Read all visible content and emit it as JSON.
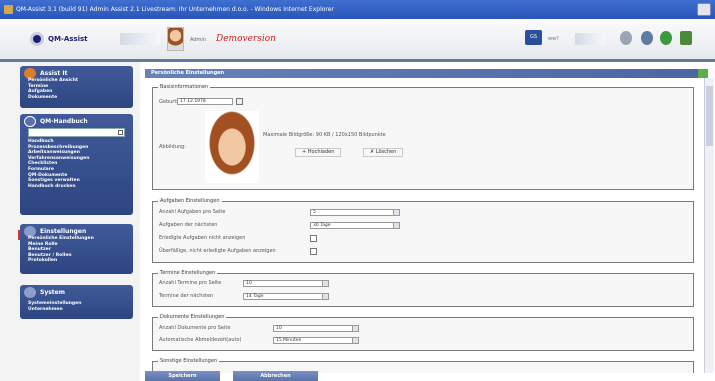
{
  "window": {
    "title": "QM-Assist 3.1 (build 91) Admin Assist 2.1 Livestream: Ihr Unternehmen d.o.o. - Windows Internet Explorer"
  },
  "header": {
    "logo_text": "QM-Assist",
    "user_name": "Admin",
    "demo_label": "Demoversion",
    "gs_badge": "GS",
    "gs_text": "ww?"
  },
  "sidebar": {
    "assist": {
      "title": "Assist It",
      "items": [
        "Persönliche Ansicht",
        "Termine",
        "Aufgaben",
        "Dokumente"
      ]
    },
    "handbook": {
      "title": "QM-Handbuch",
      "items": [
        "Handbuch",
        "Prozessbeschreibungen",
        "Arbeitsanweisungen",
        "Verfahrensanweisungen",
        "Checklisten",
        "Formulare",
        "QM-Dokumente",
        "Sonstiges verwalten",
        "Handbuch drucken"
      ]
    },
    "settings": {
      "title": "Einstellungen",
      "items": [
        "Persönliche Einstellungen",
        "Meine Rolle",
        "Benutzer",
        "Benutzer / Rollen",
        "Protokollen"
      ]
    },
    "system": {
      "title": "System",
      "items": [
        "Systemeinstellungen",
        "Unternehmen"
      ]
    }
  },
  "main": {
    "title": "Persönliche Einstellungen",
    "basic": {
      "title": "Basisinformationen",
      "birthday_label": "Geburtstag:",
      "birthday_value": "17.12.1978",
      "photo_label": "Abbildung:",
      "max_size_text": "Maximale Bildgröße: 90 KB / 120x150 Bildpunkte",
      "upload_label": "+ Hochladen",
      "delete_label": "✗ Löschen"
    },
    "tasks": {
      "title": "Aufgaben Einstellungen",
      "rows": [
        {
          "label": "Anzahl Aufgaben pro Seite",
          "value": "5"
        },
        {
          "label": "Aufgaben der nächsten",
          "value": "30 Tage"
        },
        {
          "label": "Erledigte Aufgaben nicht anzeigen"
        },
        {
          "label": "Überfällige, nicht erledigte Aufgaben anzeigen"
        }
      ]
    },
    "appointments": {
      "title": "Termine Einstellungen",
      "rows": [
        {
          "label": "Anzahl Termine pro Seite",
          "value": "10"
        },
        {
          "label": "Termine der nächsten",
          "value": "14 Tage"
        }
      ]
    },
    "documents": {
      "title": "Dokumente Einstellungen",
      "rows": [
        {
          "label": "Anzahl Dokumente pro Seite",
          "value": "10"
        },
        {
          "label": "Automatische Abmeldezeit(auto)",
          "value": "15 Minuten"
        }
      ]
    },
    "other": {
      "title": "Sonstige Einstellungen"
    }
  },
  "footer": {
    "save_label": "Speichern",
    "reset_label": "Abbrechen"
  }
}
